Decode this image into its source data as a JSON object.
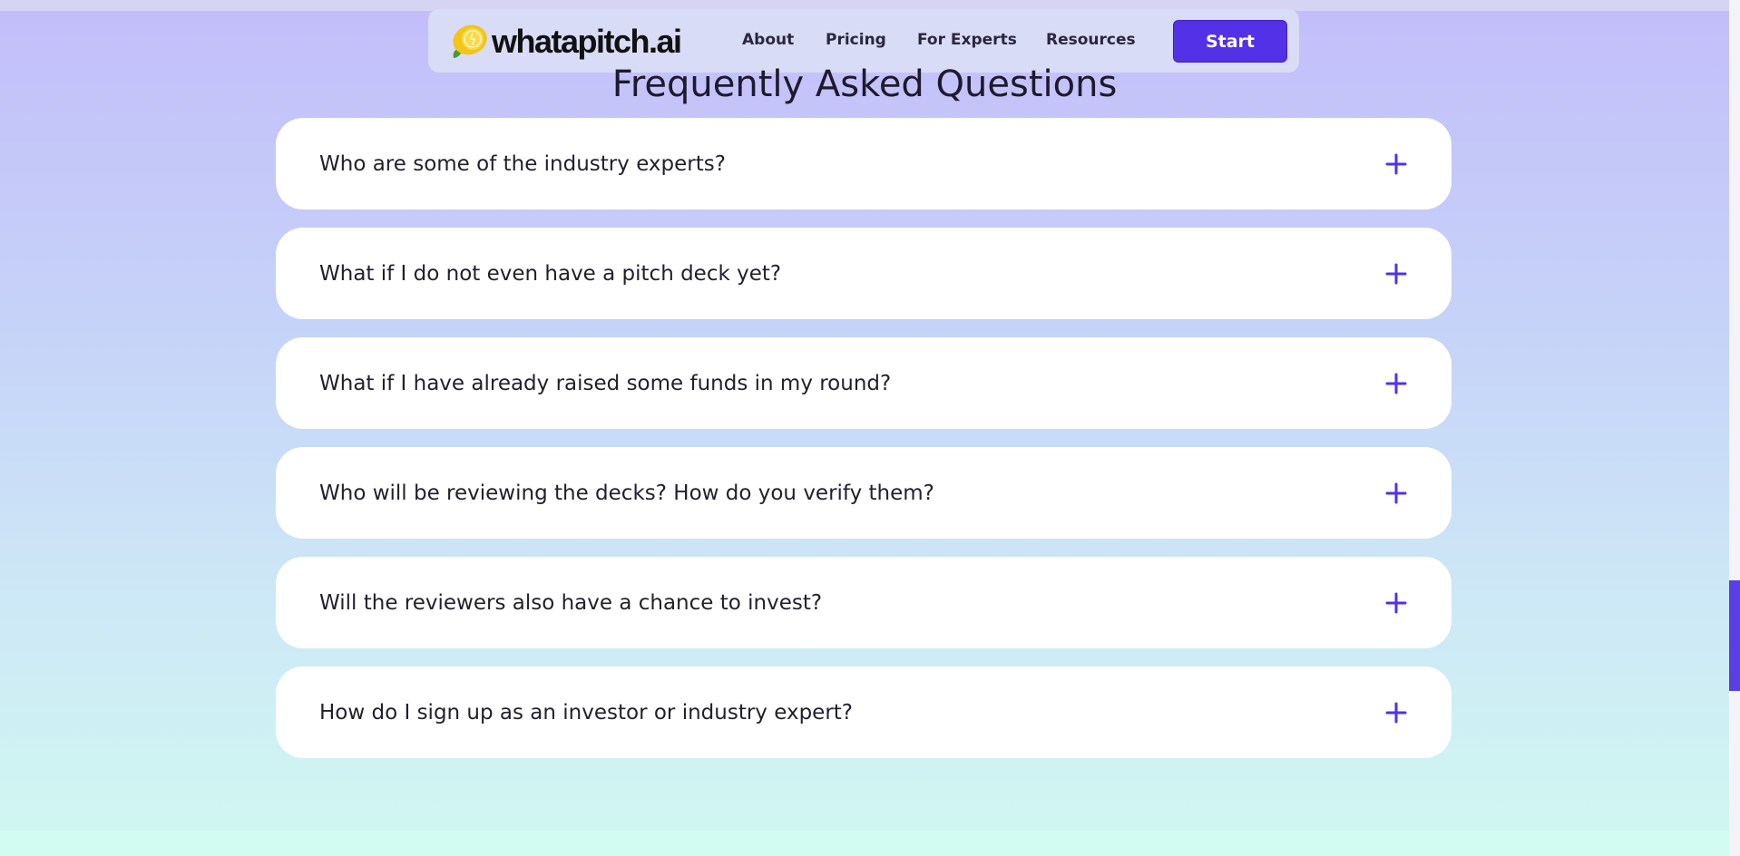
{
  "nav": {
    "logo_text": "whatapitch.ai",
    "links": [
      "About",
      "Pricing",
      "For Experts",
      "Resources"
    ],
    "cta_label": "Start"
  },
  "faq": {
    "title": "Frequently Asked Questions",
    "items": [
      {
        "question": "Who are some of the industry experts?"
      },
      {
        "question": "What if I do not even have a pitch deck yet?"
      },
      {
        "question": "What if I have already raised some funds in my round?"
      },
      {
        "question": "Who will be reviewing the decks? How do you verify them?"
      },
      {
        "question": "Will the reviewers also have a chance to invest?"
      },
      {
        "question": "How do I sign up as an investor or industry expert?"
      }
    ],
    "toggle_icon": "plus-icon"
  },
  "colors": {
    "accent": "#5331e6",
    "card": "#ffffff",
    "text": "#221f2e"
  }
}
